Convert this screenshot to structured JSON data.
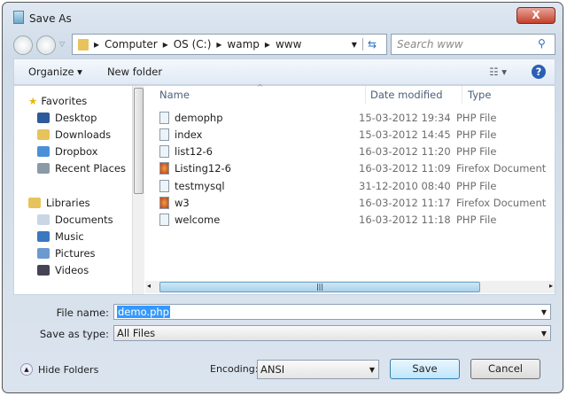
{
  "window": {
    "title": "Save As",
    "close_label": "X"
  },
  "address": {
    "segments": [
      "Computer",
      "OS (C:)",
      "wamp",
      "www"
    ],
    "search_placeholder": "Search www"
  },
  "toolbar": {
    "organize": "Organize ▾",
    "new_folder": "New folder",
    "views": "☷ ▾",
    "help": "?"
  },
  "sidebar": {
    "favorites_label": "Favorites",
    "favorites": [
      "Desktop",
      "Downloads",
      "Dropbox",
      "Recent Places"
    ],
    "libraries_label": "Libraries",
    "libraries": [
      "Documents",
      "Music",
      "Pictures",
      "Videos"
    ]
  },
  "columns": {
    "name": "Name",
    "date": "Date modified",
    "type": "Type"
  },
  "files": [
    {
      "name": "demophp",
      "date": "15-03-2012 19:34",
      "type": "PHP File",
      "icon": "php"
    },
    {
      "name": "index",
      "date": "15-03-2012 14:45",
      "type": "PHP File",
      "icon": "php"
    },
    {
      "name": "list12-6",
      "date": "16-03-2012 11:20",
      "type": "PHP File",
      "icon": "php"
    },
    {
      "name": "Listing12-6",
      "date": "16-03-2012 11:09",
      "type": "Firefox Document",
      "icon": "firefox"
    },
    {
      "name": "testmysql",
      "date": "31-12-2010 08:40",
      "type": "PHP File",
      "icon": "php"
    },
    {
      "name": "w3",
      "date": "16-03-2012 11:17",
      "type": "Firefox Document",
      "icon": "firefox"
    },
    {
      "name": "welcome",
      "date": "16-03-2012 11:18",
      "type": "PHP File",
      "icon": "php"
    }
  ],
  "form": {
    "filename_label": "File name:",
    "filename_value": "demo.php",
    "type_label": "Save as type:",
    "type_value": "All Files",
    "encoding_label": "Encoding:",
    "encoding_value": "ANSI"
  },
  "buttons": {
    "hide_folders": "Hide Folders",
    "save": "Save",
    "cancel": "Cancel"
  }
}
